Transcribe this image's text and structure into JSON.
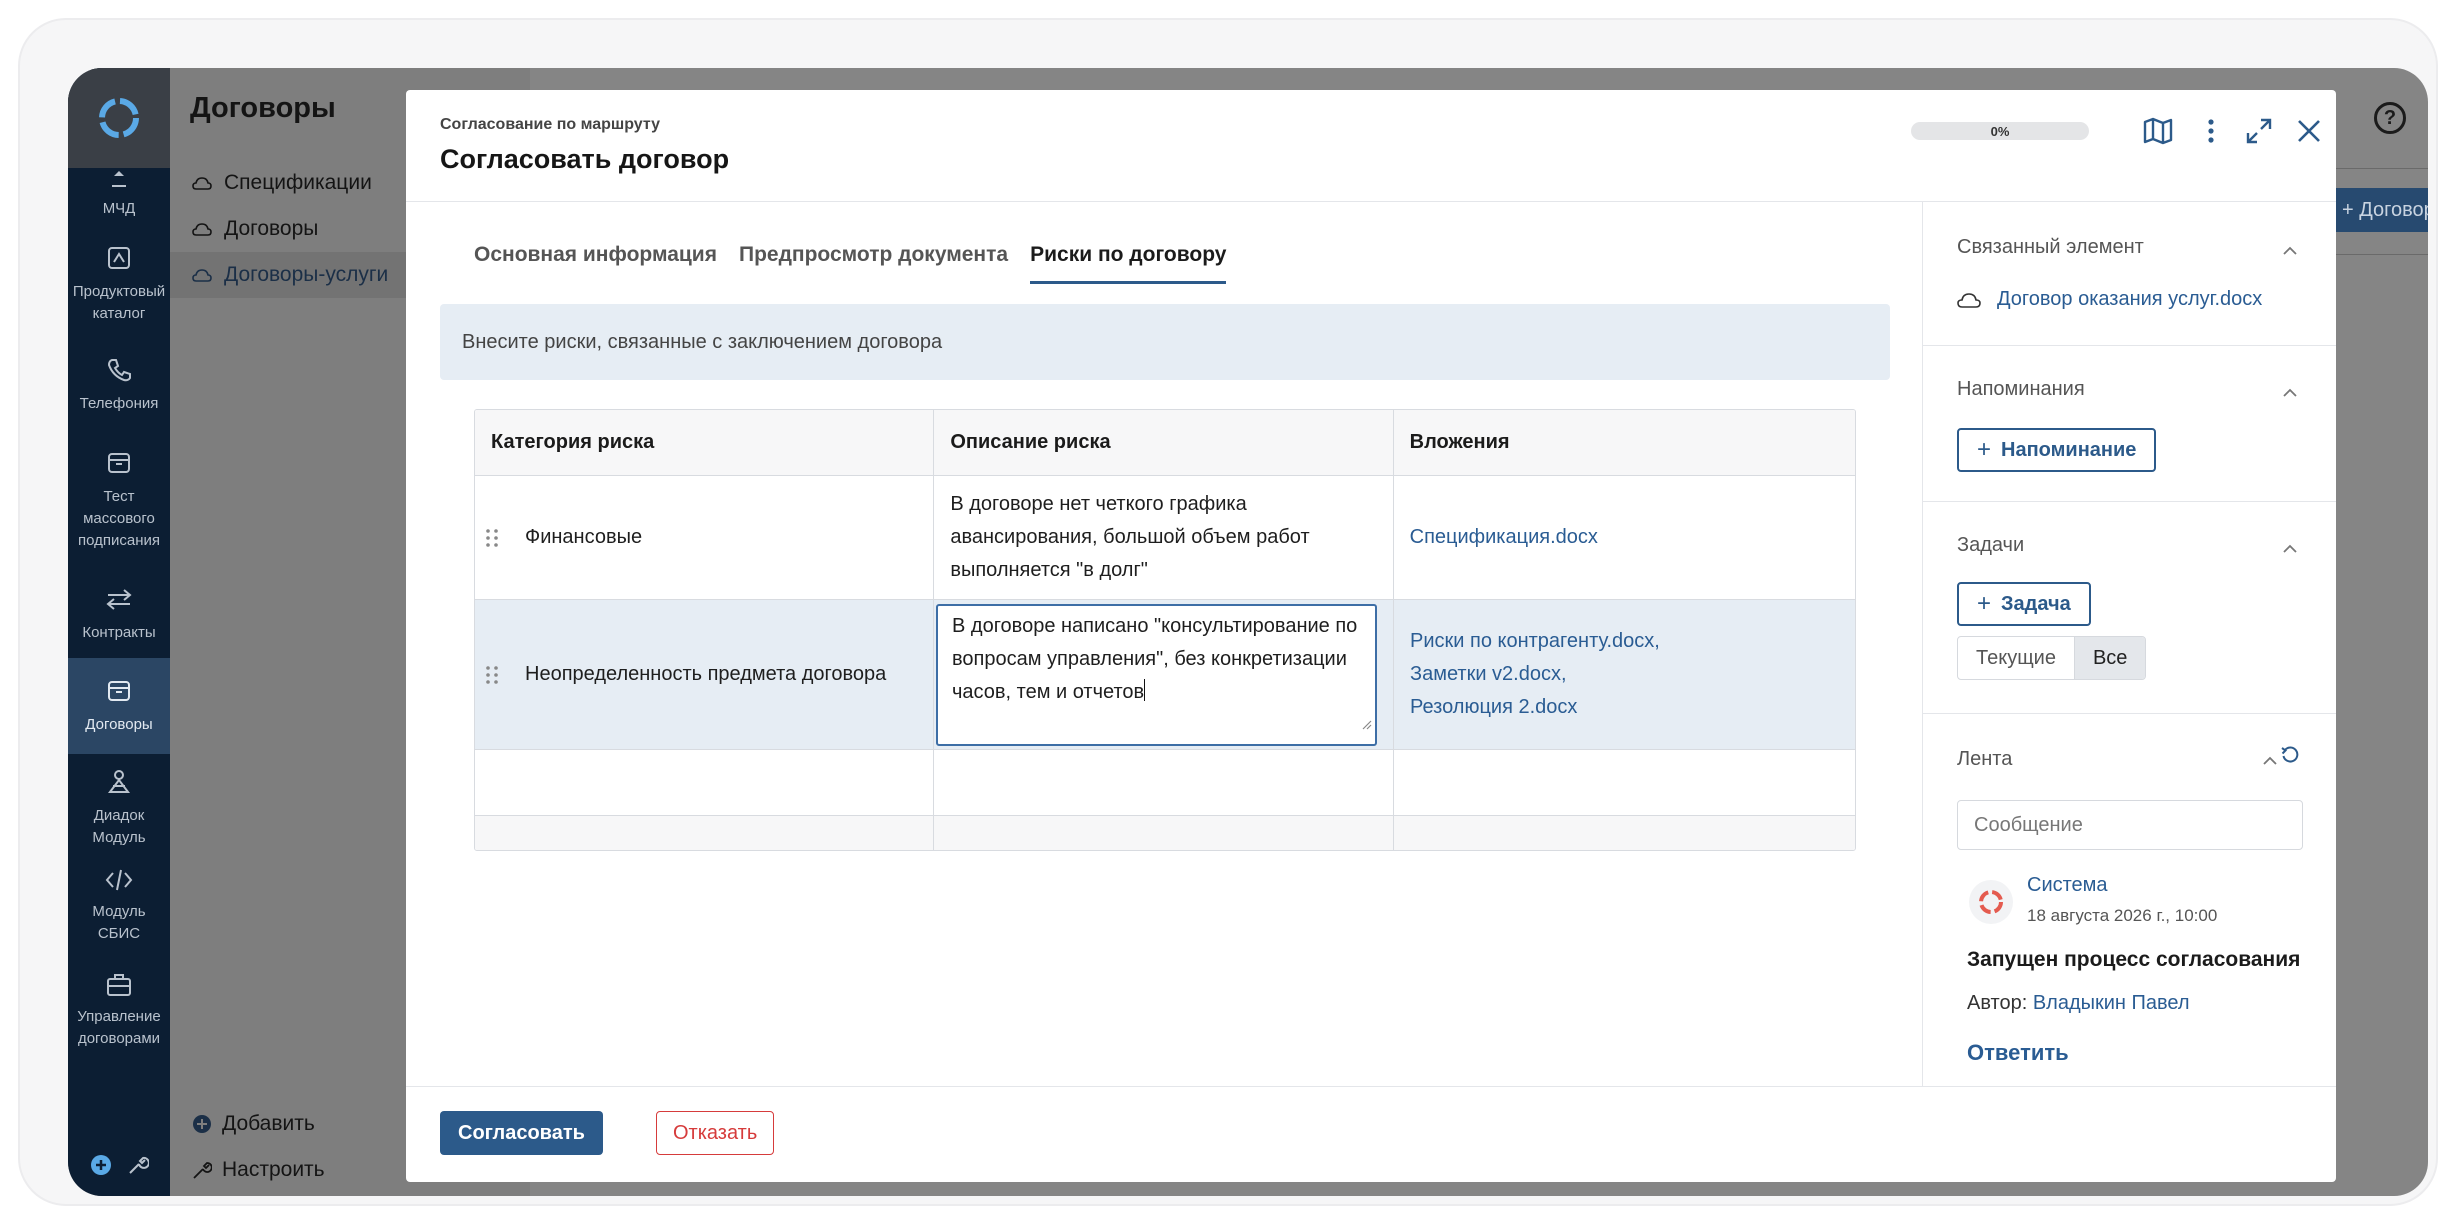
{
  "app": {
    "rail": [
      {
        "label": "МЧД",
        "icon": "upload-icon"
      },
      {
        "label": "Продуктовый каталог",
        "icon": "catalog-icon"
      },
      {
        "label": "Телефония",
        "icon": "phone-icon"
      },
      {
        "label": "Тест массового подписания",
        "icon": "archive-icon"
      },
      {
        "label": "Контракты",
        "icon": "arrows-icon"
      },
      {
        "label": "Договоры",
        "icon": "archive-icon",
        "active": true
      },
      {
        "label": "Диадок Модуль",
        "icon": "diadoc-icon"
      },
      {
        "label": "Модуль СБИС",
        "icon": "code-icon"
      },
      {
        "label": "Управление договорами",
        "icon": "briefcase-icon"
      }
    ]
  },
  "sidebar": {
    "title": "Договоры",
    "items": [
      {
        "label": "Спецификации"
      },
      {
        "label": "Договоры"
      },
      {
        "label": "Договоры-услуги",
        "active": true
      }
    ],
    "add_label": "Добавить",
    "settings_label": "Настроить"
  },
  "background": {
    "help": "?",
    "add_button": "+ Договор"
  },
  "modal": {
    "subtitle": "Согласование по маршруту",
    "title": "Согласовать договор",
    "progress": "0%",
    "progress_value": 0,
    "tabs": [
      {
        "label": "Основная информация"
      },
      {
        "label": "Предпросмотр документа"
      },
      {
        "label": "Риски по договору",
        "active": true
      }
    ],
    "notice": "Внесите риски, связанные с заключением договора",
    "table": {
      "headers": [
        "Категория риска",
        "Описание риска",
        "Вложения"
      ],
      "rows": [
        {
          "category": "Финансовые",
          "description": "В договоре нет четкого графика авансирования, большой объем работ выполняется \"в долг\"",
          "attachments": [
            "Спецификация.docx"
          ]
        },
        {
          "category": "Неопределенность предмета договора",
          "description": "В договоре написано \"консультирование по вопросам управления\", без конкретизации часов, тем и отчетов",
          "attachments": [
            "Риски по контрагенту.docx,",
            "Заметки v2.docx,",
            "Резолюция 2.docx"
          ]
        }
      ]
    },
    "right": {
      "linked": {
        "title": "Связанный элемент",
        "doc": "Договор оказания услуг.docx"
      },
      "reminders": {
        "title": "Напоминания",
        "button": "Напоминание"
      },
      "tasks": {
        "title": "Задачи",
        "button": "Задача",
        "seg_current": "Текущие",
        "seg_all": "Все"
      },
      "feed": {
        "title": "Лента",
        "placeholder": "Сообщение",
        "author_name": "Система",
        "date": "18 августа 2026 г., 10:00",
        "text": "Запущен процесс согласования",
        "author_label": "Автор:",
        "author_link": "Владыкин Павел",
        "reply": "Ответить"
      }
    },
    "footer": {
      "approve": "Согласовать",
      "reject": "Отказать"
    }
  },
  "colors": {
    "primary": "#2c5a8a",
    "link": "#2a5c93",
    "danger": "#d63b3b",
    "rail_bg": "#0c1e33"
  }
}
